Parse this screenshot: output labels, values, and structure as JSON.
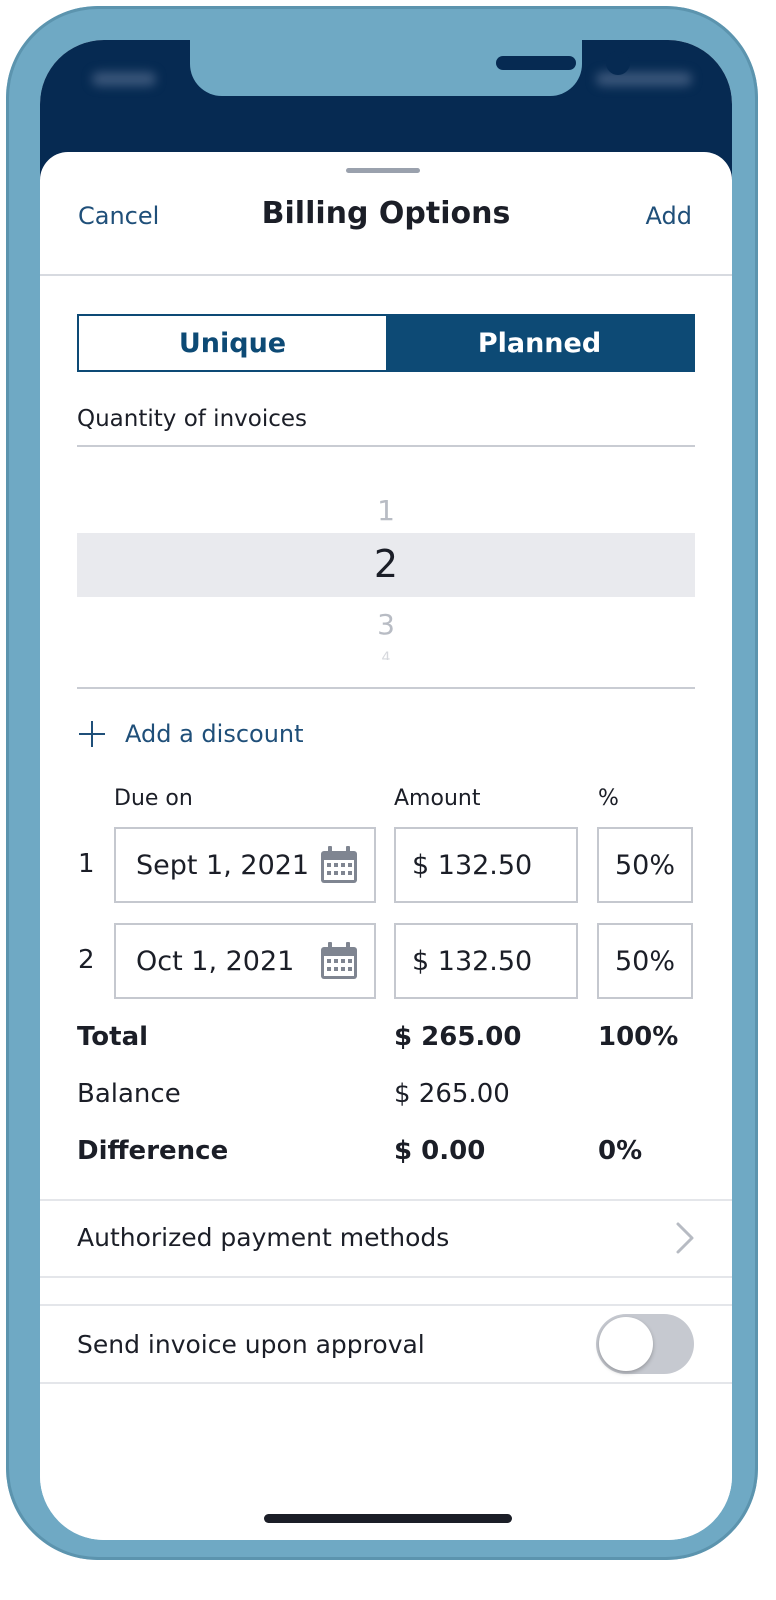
{
  "nav": {
    "cancel": "Cancel",
    "title": "Billing Options",
    "add": "Add"
  },
  "segmented": {
    "options": [
      "Unique",
      "Planned"
    ],
    "selected": "Planned"
  },
  "quantity": {
    "label": "Quantity of invoices",
    "picker_values": [
      "1",
      "2",
      "3",
      "4"
    ],
    "selected": "2"
  },
  "discount": {
    "label": "Add a discount",
    "icon": "plus-icon"
  },
  "installments": {
    "headers": {
      "due_on": "Due on",
      "amount": "Amount",
      "percent": "%"
    },
    "rows": [
      {
        "index": "1",
        "date": "Sept 1, 2021",
        "amount": "$ 132.50",
        "percent": "50%"
      },
      {
        "index": "2",
        "date": "Oct 1, 2021",
        "amount": "$ 132.50",
        "percent": "50%"
      }
    ]
  },
  "summary": {
    "total": {
      "label": "Total",
      "amount": "$ 265.00",
      "percent": "100%"
    },
    "balance": {
      "label": "Balance",
      "amount": "$ 265.00"
    },
    "difference": {
      "label": "Difference",
      "amount": "$ 0.00",
      "percent": "0%"
    }
  },
  "payment_methods": {
    "label": "Authorized payment methods",
    "icon": "chevron-right-icon"
  },
  "send_invoice": {
    "label": "Send invoice upon approval",
    "enabled": false
  },
  "colors": {
    "brand": "#0d4a75",
    "link": "#1f4f79",
    "header_bg": "#062a52",
    "frame": "#6fa9c4"
  }
}
